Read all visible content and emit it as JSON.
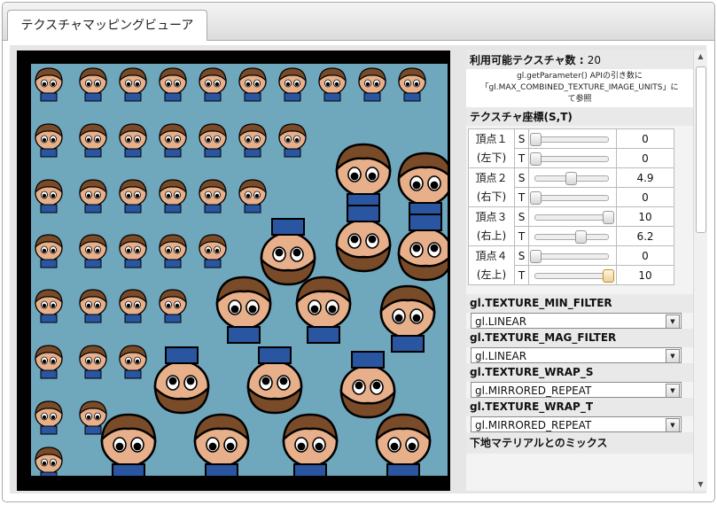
{
  "tab": {
    "label": "テクスチャマッピングビューア"
  },
  "panel": {
    "available_textures_label": "利用可能テクスチャ数 :",
    "available_textures_value": "20",
    "note_line1": "gl.getParameter() APIの引き数に",
    "note_line2": "「gl.MAX_COMBINED_TEXTURE_IMAGE_UNITS」に",
    "note_line3": "て参照",
    "coords_header": "テクスチャ座標(S,T)",
    "vertices": [
      {
        "name": "頂点１",
        "pos": "(左下)",
        "s": {
          "label": "S",
          "value": "0",
          "fraction": 0.0
        },
        "t": {
          "label": "T",
          "value": "0",
          "fraction": 0.0
        }
      },
      {
        "name": "頂点２",
        "pos": "(右下)",
        "s": {
          "label": "S",
          "value": "4.9",
          "fraction": 0.49
        },
        "t": {
          "label": "T",
          "value": "0",
          "fraction": 0.0
        }
      },
      {
        "name": "頂点３",
        "pos": "(右上)",
        "s": {
          "label": "S",
          "value": "10",
          "fraction": 1.0
        },
        "t": {
          "label": "T",
          "value": "6.2",
          "fraction": 0.62
        }
      },
      {
        "name": "頂点４",
        "pos": "(左上)",
        "s": {
          "label": "S",
          "value": "0",
          "fraction": 0.0
        },
        "t": {
          "label": "T",
          "value": "10",
          "fraction": 1.0
        }
      }
    ],
    "min_filter": {
      "label": "gl.TEXTURE_MIN_FILTER",
      "value": "gl.LINEAR"
    },
    "mag_filter": {
      "label": "gl.TEXTURE_MAG_FILTER",
      "value": "gl.LINEAR"
    },
    "wrap_s": {
      "label": "gl.TEXTURE_WRAP_S",
      "value": "gl.MIRRORED_REPEAT"
    },
    "wrap_t": {
      "label": "gl.TEXTURE_WRAP_T",
      "value": "gl.MIRRORED_REPEAT"
    },
    "mix_header": "下地マテリアルとのミックス"
  },
  "icons": {
    "dropdown": "chevron-down-icon",
    "scroll_up": "arrow-up-icon",
    "scroll_down": "arrow-down-icon"
  }
}
